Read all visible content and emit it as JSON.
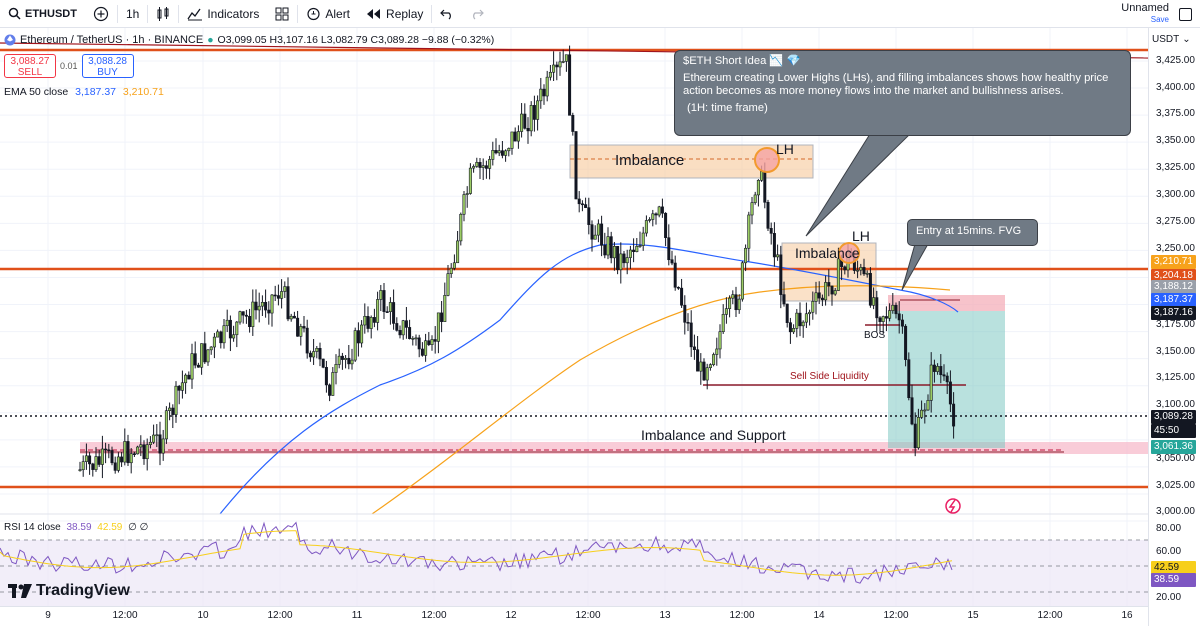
{
  "toolbar": {
    "symbol": "ETHUSDT",
    "interval": "1h",
    "indicators_label": "Indicators",
    "alert_label": "Alert",
    "replay_label": "Replay",
    "layout_name": "Unnamed",
    "save_label": "Save"
  },
  "legend": {
    "title": "Ethereum / TetherUS · 1h · BINANCE",
    "ohlc": "O3,099.05 H3,107.16 L3,082.79 C3,089.28 −9.88 (−0.32%)",
    "sell_price": "3,088.27",
    "sell_label": "SELL",
    "spread": "0.01",
    "buy_price": "3,088.28",
    "buy_label": "BUY",
    "ema_label": "EMA 50 close",
    "ema_val1": "3,187.37",
    "ema_val2": "3,210.71",
    "rsi_label": "RSI 14 close",
    "rsi_val1": "38.59",
    "rsi_val2": "42.59",
    "rsi_val3": "∅ ∅"
  },
  "annotations": {
    "callout_title": "$ETH Short Idea 📉 💎",
    "callout_body": "Ethereum creating Lower Highs (LHs), and filling imbalances shows how healthy price action becomes as more money flows into the market and bullishness arises.",
    "callout_tf": "(1H: time frame)",
    "entry": "Entry at 15mins. FVG",
    "imbalance1": "Imbalance",
    "imbalance2": "Imbalance",
    "lh1": "LH",
    "lh2": "LH",
    "bos": "BOS",
    "sell_side": "Sell Side Liquidity",
    "support": "Imbalance and Support"
  },
  "price_axis": {
    "currency": "USDT",
    "ticks": [
      "3,425.00",
      "3,400.00",
      "3,375.00",
      "3,350.00",
      "3,325.00",
      "3,300.00",
      "3,275.00",
      "3,250.00",
      "3,175.00",
      "3,150.00",
      "3,125.00",
      "3,100.00",
      "3,050.00",
      "3,025.00",
      "3,000.00"
    ],
    "rsi_ticks": [
      "80.00",
      "60.00",
      "20.00"
    ],
    "tags": [
      {
        "value": "3,210.71",
        "color": "#f7a21b"
      },
      {
        "value": "3,204.18",
        "color": "#e0501a"
      },
      {
        "value": "3,188.12",
        "color": "#9aa0aa"
      },
      {
        "value": "3,187.37",
        "color": "#2962ff"
      },
      {
        "value": "3,187.16",
        "color": "#131722"
      },
      {
        "value": "3,089.28",
        "color": "#131722"
      },
      {
        "value": "45:50",
        "color": "#131722"
      },
      {
        "value": "3,061.36",
        "color": "#26a69a"
      },
      {
        "value": "42.59",
        "color": "#f7cf1b"
      },
      {
        "value": "38.59",
        "color": "#7e57c2"
      }
    ]
  },
  "time_axis": {
    "ticks": [
      "9",
      "12:00",
      "10",
      "12:00",
      "11",
      "12:00",
      "12",
      "12:00",
      "13",
      "12:00",
      "14",
      "12:00",
      "15",
      "12:00",
      "16"
    ]
  },
  "branding": {
    "logo": "TradingView"
  },
  "colors": {
    "up": "#26a69a",
    "down": "#131722",
    "orange_line": "#e0501a",
    "ema": "#2962ff",
    "ema_long": "#f7a21b",
    "rsi": "#7e57c2"
  }
}
